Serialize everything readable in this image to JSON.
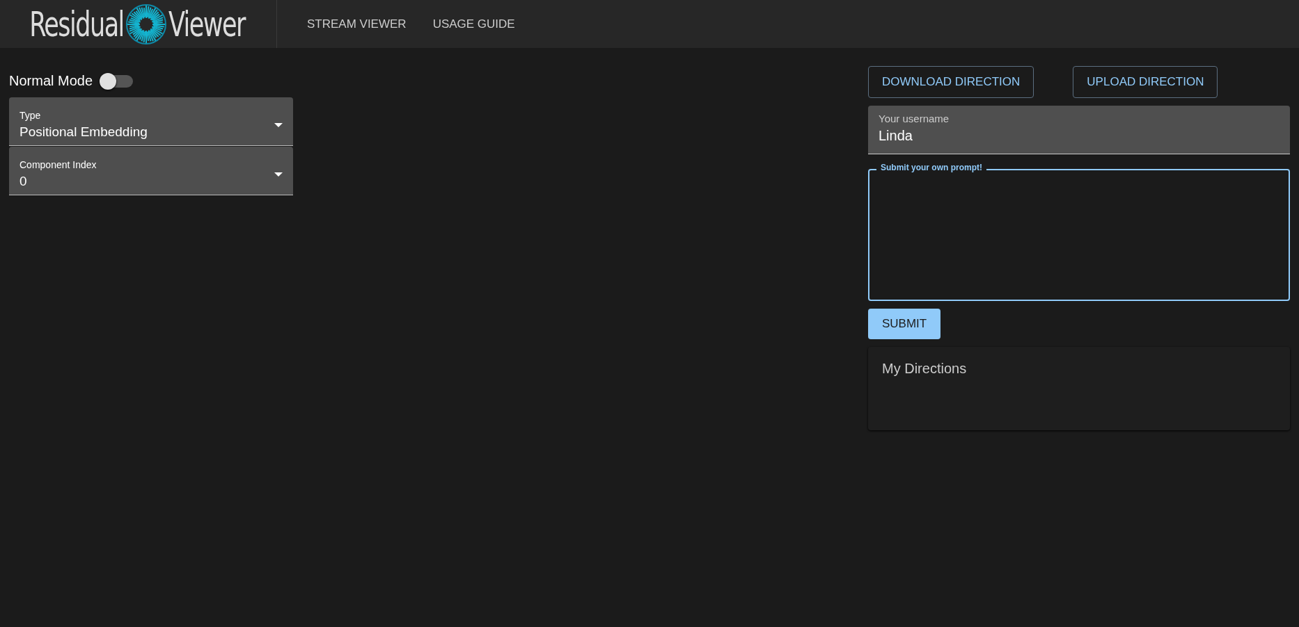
{
  "header": {
    "logo": {
      "left": "Residual",
      "right": "Viewer"
    },
    "nav": [
      {
        "label": "STREAM VIEWER"
      },
      {
        "label": "USAGE GUIDE"
      }
    ]
  },
  "left": {
    "mode_toggle": {
      "label": "Normal Mode",
      "on": false
    },
    "selects": [
      {
        "label": "Type",
        "value": "Positional Embedding"
      },
      {
        "label": "Component Index",
        "value": "0"
      }
    ]
  },
  "right": {
    "buttons": [
      {
        "label": "DOWNLOAD DIRECTION"
      },
      {
        "label": "UPLOAD DIRECTION"
      }
    ],
    "username": {
      "label": "Your username",
      "value": "Linda"
    },
    "prompt": {
      "label": "Submit your own prompt!"
    },
    "submit": {
      "label": "SUBMIT"
    },
    "directions": {
      "title": "My Directions"
    }
  }
}
